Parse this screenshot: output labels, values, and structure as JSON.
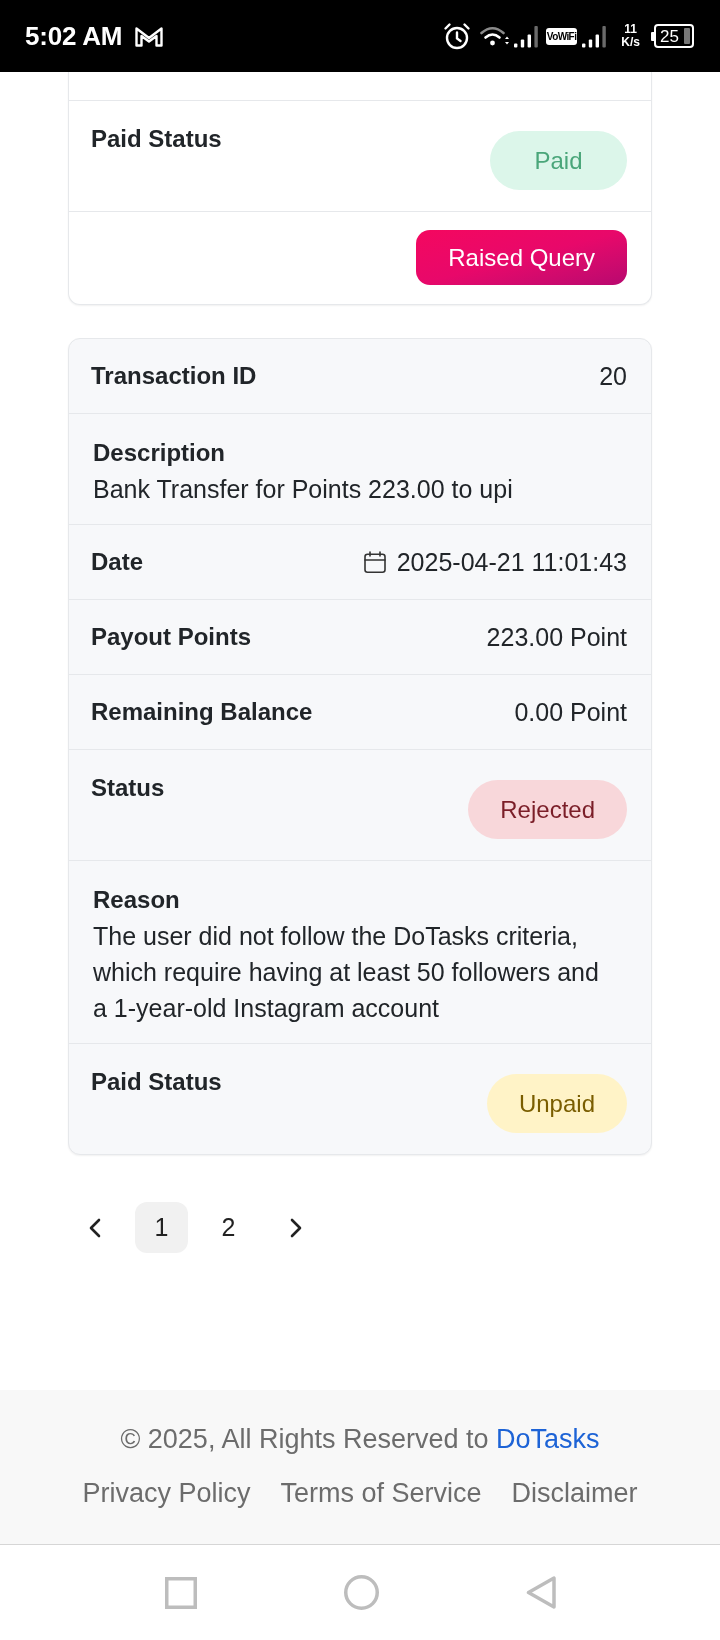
{
  "status_bar": {
    "time": "5:02 AM",
    "network_label": "VoWiFi",
    "speed_value": "11",
    "speed_unit": "K/s",
    "battery": "25"
  },
  "cards": [
    {
      "clipped_top": true,
      "color": "#ffffff",
      "rows": [
        {
          "kind": "badge",
          "label": "Paid Status",
          "badge": {
            "text": "Paid",
            "kind": "success"
          }
        },
        {
          "kind": "action",
          "button": "Raised Query"
        }
      ]
    },
    {
      "color": "#f7f8fa",
      "rows": [
        {
          "kind": "inline",
          "label": "Transaction ID",
          "value": "20"
        },
        {
          "kind": "stacked",
          "label": "Description",
          "value": "Bank Transfer for Points 223.00 to upi"
        },
        {
          "kind": "date",
          "label": "Date",
          "value": "2025-04-21 11:01:43"
        },
        {
          "kind": "inline",
          "label": "Payout Points",
          "value": "223.00 Point"
        },
        {
          "kind": "inline",
          "label": "Remaining Balance",
          "value": "0.00 Point"
        },
        {
          "kind": "badge",
          "label": "Status",
          "badge": {
            "text": "Rejected",
            "kind": "danger"
          }
        },
        {
          "kind": "stacked",
          "label": "Reason",
          "value": "The user did not follow the DoTasks criteria, which require having at least 50 followers and a 1-year-old Instagram account"
        },
        {
          "kind": "badge",
          "label": "Paid Status",
          "badge": {
            "text": "Unpaid",
            "kind": "warning"
          }
        }
      ]
    }
  ],
  "pagination": {
    "pages": [
      {
        "label": "1",
        "selected": true
      },
      {
        "label": "2",
        "selected": false
      }
    ]
  },
  "footer": {
    "copyright": "© 2025, All Rights Reserved to",
    "brand_link": "DoTasks",
    "links": [
      "Privacy Policy",
      "Terms of Service",
      "Disclaimer"
    ]
  }
}
